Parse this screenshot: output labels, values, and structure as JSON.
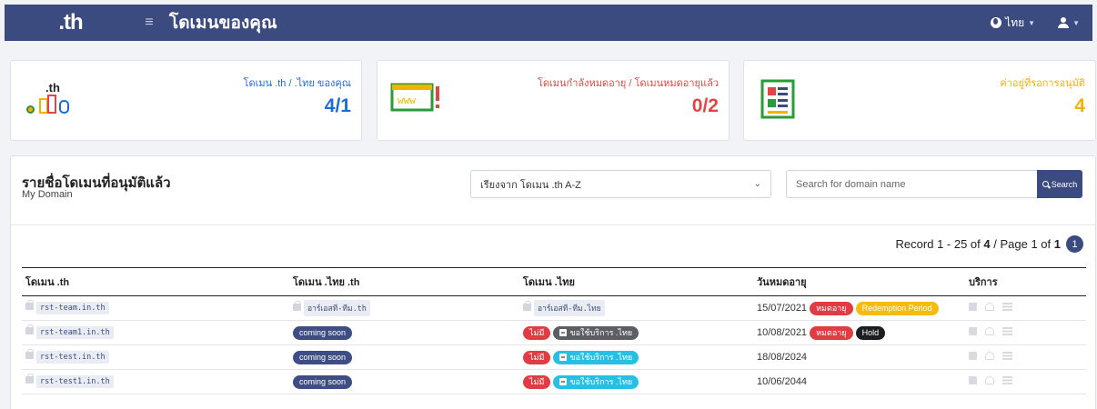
{
  "topbar": {
    "brand": ".th",
    "menu_icon": "hamburger-icon",
    "title": "โดเมนของคุณ",
    "language": "ไทย",
    "background": "#3b4a7f"
  },
  "stats": [
    {
      "label": ".th / .ไทย ของคุณ",
      "label_prefix": "โดเมน",
      "value": "4/1",
      "color": "#1e6bd8",
      "icon": "th-domains-icon"
    },
    {
      "label": "โดเมนกำลังหมดอายุ / โดเมนหมดอายุแล้ว",
      "value": "0/2",
      "color": "#e04646",
      "icon": "www-warning-icon"
    },
    {
      "label": "ค่าอยู่ที่รอการอนุมัติ",
      "value": "4",
      "color": "#f0b400",
      "icon": "pending-form-icon"
    }
  ],
  "domain_list": {
    "title": "รายชื่อโดเมนที่อนุมัติแล้ว",
    "subtitle": "My Domain",
    "sort_value": "เรียงจาก โดเมน .th A-Z",
    "search_placeholder": "Search for domain name",
    "search_button": "Search",
    "record_prefix": "Record 1 - 25 of",
    "record_total": "4",
    "record_page_prefix": "/ Page 1 of",
    "record_pages": "1",
    "current_page": "1",
    "columns": [
      "โดเมน .th",
      "โดเมน .ไทย .th",
      "โดเมน .ไทย",
      "วันหมดอายุ",
      "บริการ"
    ],
    "rows": [
      {
        "domain_th": "rst-team.in.th",
        "thai_th": "อาร์เอสที-ทีม.th",
        "thai": "อาร์เอสที-ทีม.ไทย",
        "expiry": "15/07/2021",
        "badges": [
          "หมดอายุ",
          "Redemption Period"
        ]
      },
      {
        "domain_th": "rst-team1.in.th",
        "thai_th": "coming soon",
        "thai_no": "ไม่มี",
        "thai_request": "ขอใช้บริการ .ไทย",
        "expiry": "10/08/2021",
        "badges": [
          "หมดอายุ",
          "Hold"
        ]
      },
      {
        "domain_th": "rst-test.in.th",
        "thai_th": "coming soon",
        "thai_no": "ไม่มี",
        "thai_request": "ขอใช้บริการ .ไทย",
        "expiry": "18/08/2024"
      },
      {
        "domain_th": "rst-test1.in.th",
        "thai_th": "coming soon",
        "thai_no": "ไม่มี",
        "thai_request": "ขอใช้บริการ .ไทย",
        "expiry": "10/06/2044"
      }
    ]
  }
}
